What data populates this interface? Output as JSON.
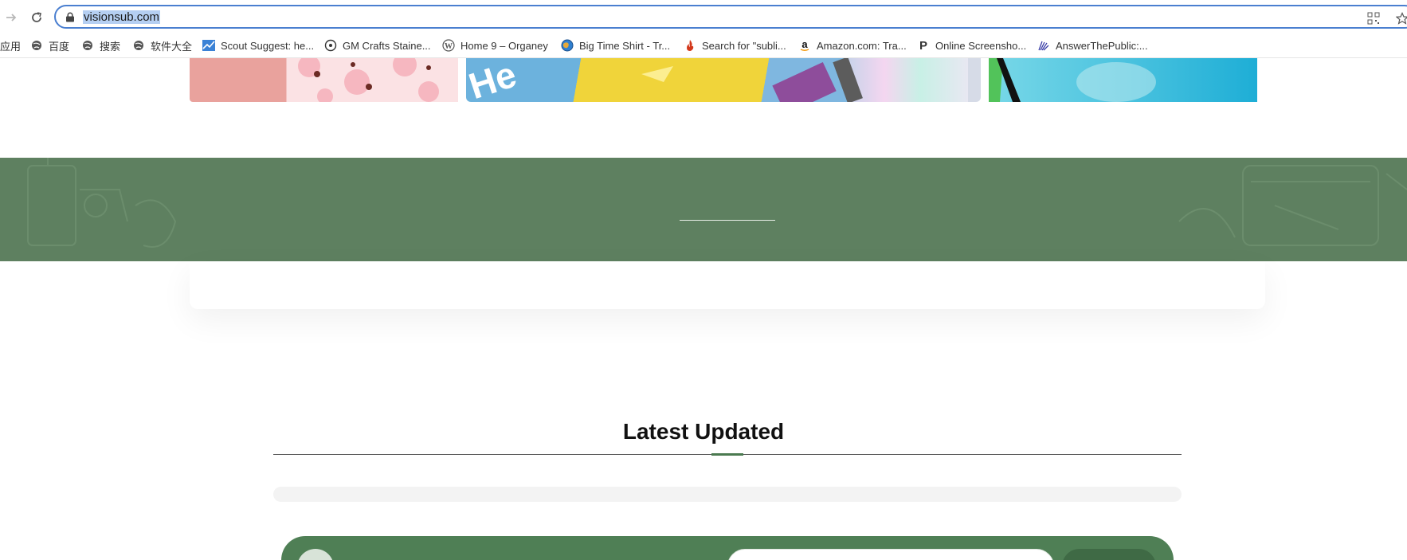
{
  "browser": {
    "url": "visionsub.com",
    "bookmarks": [
      {
        "label": "应用",
        "icon": "apps-grid-icon"
      },
      {
        "label": "百度",
        "icon": "globe-icon"
      },
      {
        "label": "搜索",
        "icon": "globe-icon"
      },
      {
        "label": "软件大全",
        "icon": "globe-icon"
      },
      {
        "label": "Scout Suggest: he...",
        "icon": "chart-icon"
      },
      {
        "label": "GM Crafts Staine...",
        "icon": "target-icon"
      },
      {
        "label": "Home 9 – Organey",
        "icon": "wordpress-icon"
      },
      {
        "label": "Big Time Shirt - Tr...",
        "icon": "globe-color-icon"
      },
      {
        "label": "Search for \"subli...",
        "icon": "flame-icon"
      },
      {
        "label": "Amazon.com: Tra...",
        "icon": "amazon-icon"
      },
      {
        "label": "Online Screensho...",
        "icon": "p-letter-icon"
      },
      {
        "label": "AnswerThePublic:...",
        "icon": "feather-icon"
      }
    ]
  },
  "main": {
    "section_title": "Latest Updated"
  },
  "colors": {
    "banner_green": "#5e8060",
    "cta_green": "#4f7f55",
    "omnibox_focus": "#4a7fd0",
    "url_selection": "#b5cff2"
  }
}
